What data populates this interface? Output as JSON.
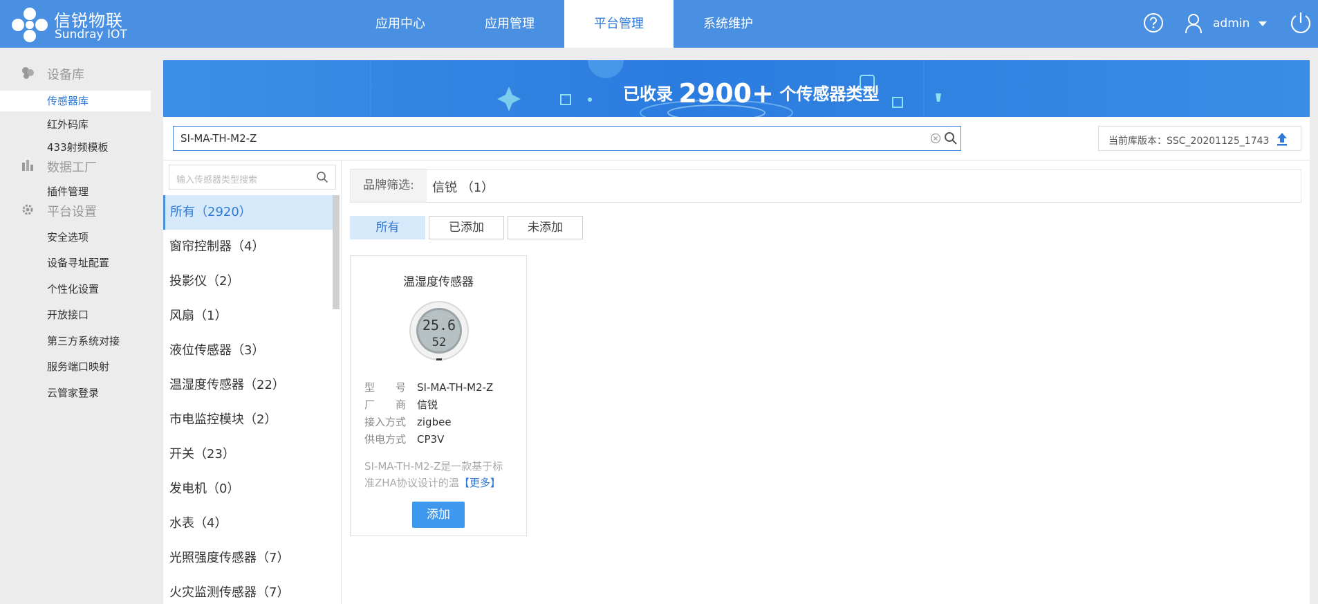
{
  "header": {
    "logo_cn": "信锐物联",
    "logo_en": "Sundray IOT",
    "nav": [
      {
        "label": "应用中心"
      },
      {
        "label": "应用管理"
      },
      {
        "label": "平台管理"
      },
      {
        "label": "系统维护"
      }
    ],
    "username": "admin"
  },
  "sidebar": {
    "groups": [
      {
        "label": "设备库",
        "icon": "device-library-icon"
      },
      {
        "label": "数据工厂",
        "icon": "data-factory-icon"
      },
      {
        "label": "平台设置",
        "icon": "gear-icon"
      }
    ],
    "items": [
      {
        "label": "传感器库"
      },
      {
        "label": "红外码库"
      },
      {
        "label": "433射频模板"
      },
      {
        "label": "插件管理"
      },
      {
        "label": "安全选项"
      },
      {
        "label": "设备寻址配置"
      },
      {
        "label": "个性化设置"
      },
      {
        "label": "开放接口"
      },
      {
        "label": "第三方系统对接"
      },
      {
        "label": "服务端口映射"
      },
      {
        "label": "云管家登录"
      }
    ]
  },
  "banner": {
    "prefix": "已收录",
    "count": "2900+",
    "suffix": "个传感器类型"
  },
  "search": {
    "value": "SI-MA-TH-M2-Z"
  },
  "version": {
    "label": "当前库版本：SSC_20201125_1743"
  },
  "category_search": {
    "placeholder": "输入传感器类型搜索"
  },
  "categories": [
    {
      "label": "所有（2920）"
    },
    {
      "label": "窗帘控制器（4）"
    },
    {
      "label": "投影仪（2）"
    },
    {
      "label": "风扇（1）"
    },
    {
      "label": "液位传感器（3）"
    },
    {
      "label": "温湿度传感器（22）"
    },
    {
      "label": "市电监控模块（2）"
    },
    {
      "label": "开关（23）"
    },
    {
      "label": "发电机（0）"
    },
    {
      "label": "水表（4）"
    },
    {
      "label": "光照强度传感器（7）"
    },
    {
      "label": "火灾监测传感器（7）"
    }
  ],
  "brand_filter": {
    "label": "品牌筛选:",
    "value": "信锐 （1）"
  },
  "tabs": [
    {
      "label": "所有"
    },
    {
      "label": "已添加"
    },
    {
      "label": "未添加"
    }
  ],
  "card": {
    "title": "温湿度传感器",
    "specs": [
      {
        "k": "型　　号",
        "v": "SI-MA-TH-M2-Z"
      },
      {
        "k": "厂　　商",
        "v": "信锐"
      },
      {
        "k": "接入方式",
        "v": "zigbee"
      },
      {
        "k": "供电方式",
        "v": "CP3V"
      }
    ],
    "desc_line1": "SI-MA-TH-M2-Z是一款基于标",
    "desc_line2": "准ZHA协议设计的温",
    "more": "【更多】",
    "add": "添加",
    "display_temp": "25.6",
    "display_hum": "52"
  },
  "colors": {
    "brand": "#4a90e2",
    "accent": "#2f7ad6",
    "button": "#3d98ee"
  }
}
